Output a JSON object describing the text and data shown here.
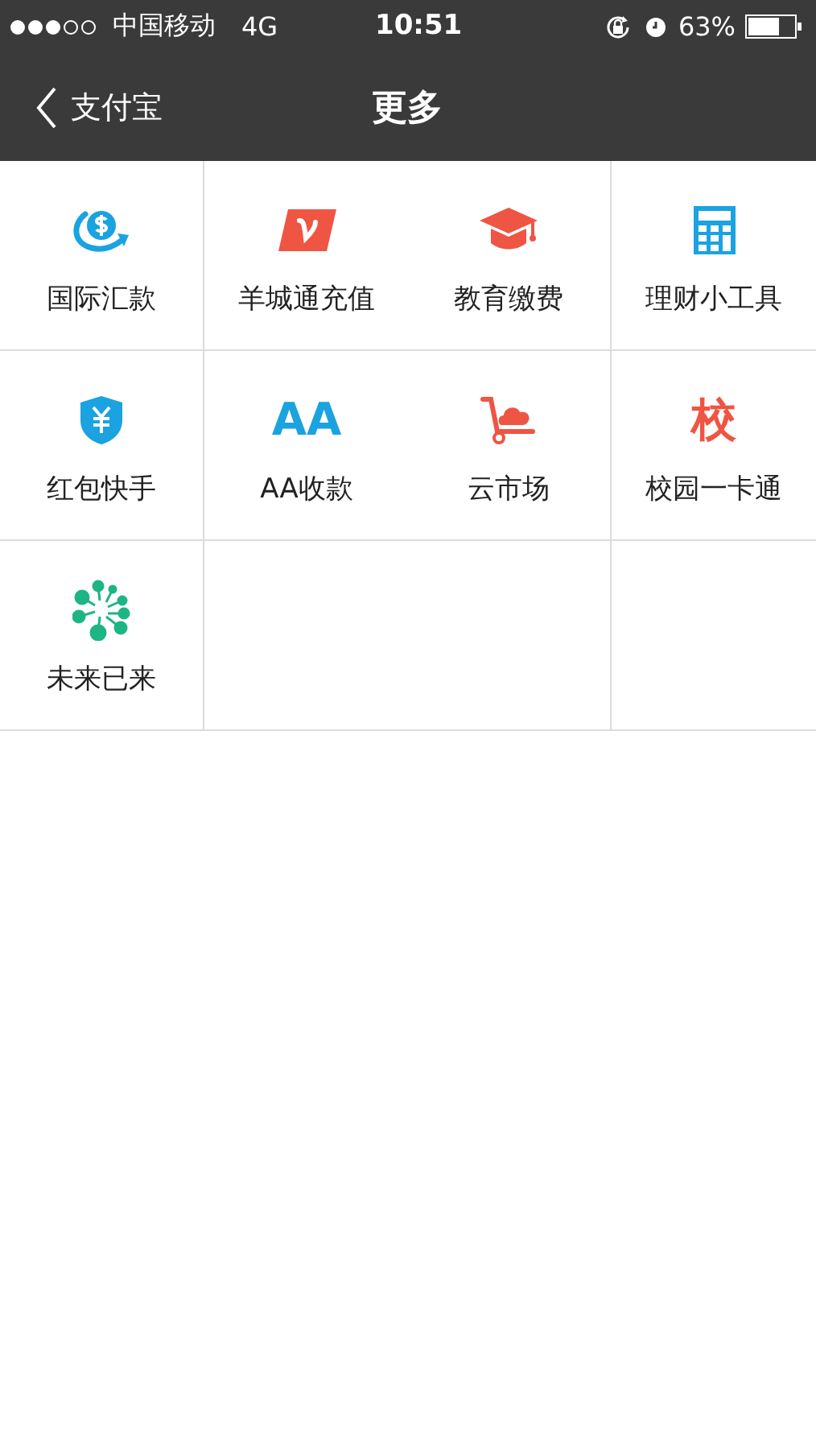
{
  "status_bar": {
    "carrier": "中国移动",
    "network": "4G",
    "time": "10:51",
    "battery": "63%"
  },
  "nav": {
    "back": "支付宝",
    "title": "更多"
  },
  "tiles": [
    {
      "kind": "dollar",
      "label": "国际汇款"
    },
    {
      "kind": "ticket",
      "label": "羊城通充值"
    },
    {
      "kind": "cap",
      "label": "教育缴费"
    },
    {
      "kind": "calculator",
      "label": "理财小工具"
    },
    {
      "kind": "shield",
      "label": "红包快手"
    },
    {
      "kind": "glyph",
      "glyph": "AA",
      "color": "#1aa3e0",
      "label": "AA收款"
    },
    {
      "kind": "cart",
      "label": "云市场"
    },
    {
      "kind": "glyph",
      "glyph": "校",
      "color": "#ef5543",
      "label": "校园一卡通"
    },
    {
      "kind": "burst",
      "label": "未来已来"
    }
  ]
}
